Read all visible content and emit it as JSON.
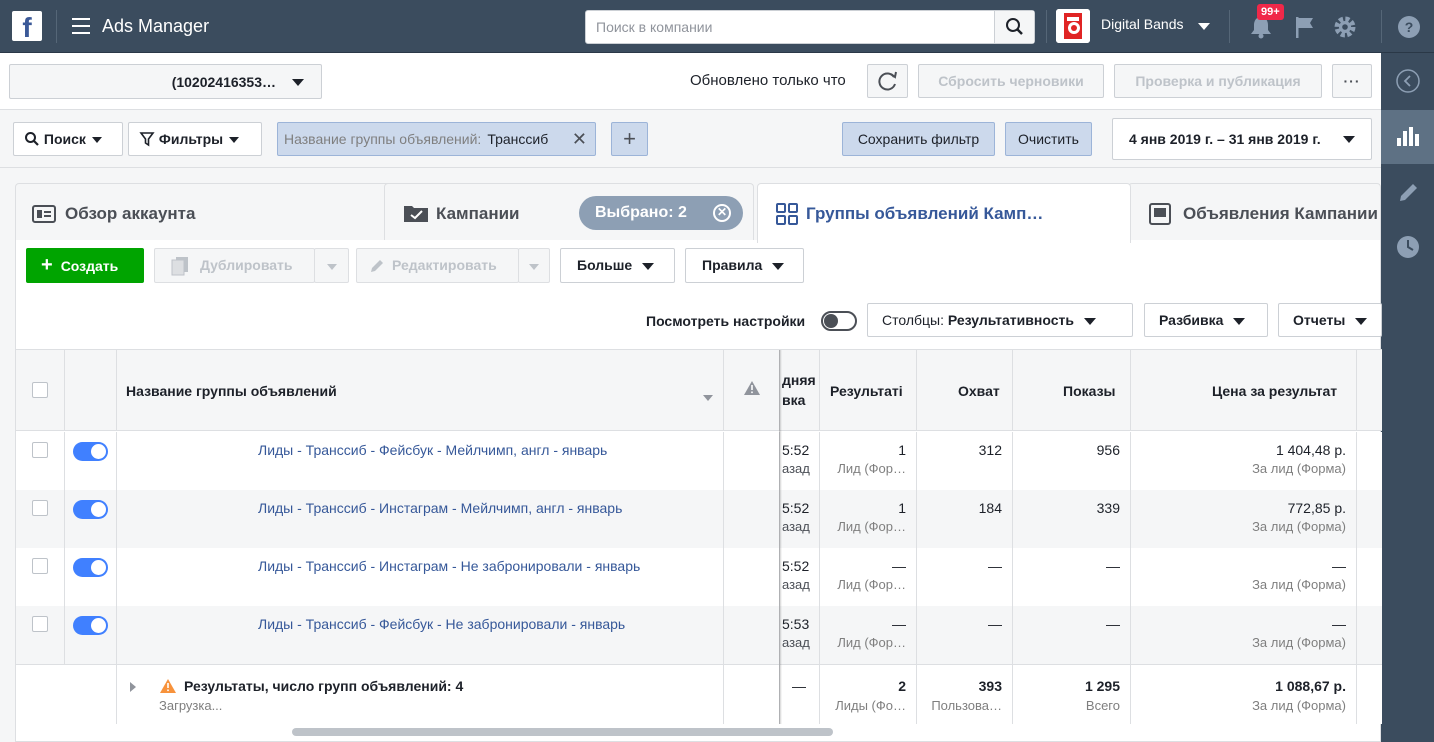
{
  "topbar": {
    "logo_letter": "f",
    "app_title": "Ads Manager",
    "search_placeholder": "Поиск в компании",
    "brand_name": "Digital Bands",
    "notifications_badge": "99+"
  },
  "account_bar": {
    "account_id": "(10202416353…",
    "updated_text": "Обновлено только что",
    "discard_label": "Сбросить черновики",
    "publish_label": "Проверка и публикация",
    "more_label": "···"
  },
  "filter_bar": {
    "search_label": "Поиск",
    "filters_label": "Фильтры",
    "chip_label": "Название группы объявлений:",
    "chip_value": "Транссиб",
    "save_filter_label": "Сохранить фильтр",
    "clear_label": "Очистить",
    "date_range": "4 янв 2019 г. – 31 янв 2019 г."
  },
  "tabs": {
    "overview": "Обзор аккаунта",
    "campaigns": "Кампании",
    "selected_pill": "Выбрано: 2",
    "adsets": "Группы объявлений Камп…",
    "ads": "Объявления Кампании"
  },
  "toolbar": {
    "create_label": "Создать",
    "duplicate_label": "Дублировать",
    "edit_label": "Редактировать",
    "more_label": "Больше",
    "rules_label": "Правила",
    "view_settings_label": "Посмотреть настройки",
    "columns_label": "Столбцы: ",
    "columns_value": "Результативность",
    "breakdown_label": "Разбивка",
    "reports_label": "Отчеты"
  },
  "table": {
    "headers": {
      "name": "Название группы объявлений",
      "partial_top": "дняя",
      "partial_bottom": "вка",
      "results": "Результаті",
      "reach": "Охват",
      "impressions": "Показы",
      "cost": "Цена за результат"
    },
    "rows": [
      {
        "name": "Лиды - Транссиб - Фейсбук - Мейлчимп, англ - январь",
        "time": "5:52",
        "time_sub": "азад",
        "results": "1",
        "results_sub": "Лид (Фор…",
        "reach": "312",
        "impressions": "956",
        "cost": "1 404,48 р.",
        "cost_sub": "За лид (Форма)"
      },
      {
        "name": "Лиды - Транссиб - Инстаграм - Мейлчимп, англ - январь",
        "time": "5:52",
        "time_sub": "азад",
        "results": "1",
        "results_sub": "Лид (Фор…",
        "reach": "184",
        "impressions": "339",
        "cost": "772,85 р.",
        "cost_sub": "За лид (Форма)"
      },
      {
        "name": "Лиды - Транссиб - Инстаграм - Не забронировали - январь",
        "time": "5:52",
        "time_sub": "азад",
        "results": "—",
        "results_sub": "Лид (Фор…",
        "reach": "—",
        "impressions": "—",
        "cost": "—",
        "cost_sub": "За лид (Форма)"
      },
      {
        "name": "Лиды - Транссиб - Фейсбук - Не забронировали - январь",
        "time": "5:53",
        "time_sub": "азад",
        "results": "—",
        "results_sub": "Лид (Фор…",
        "reach": "—",
        "impressions": "—",
        "cost": "—",
        "cost_sub": "За лид (Форма)"
      }
    ],
    "summary": {
      "title": "Результаты, число групп объявлений: 4",
      "loading": "Загрузка...",
      "time": "—",
      "results": "2",
      "results_sub": "Лиды (Фо…",
      "reach": "393",
      "reach_sub": "Пользова…",
      "impressions": "1 295",
      "impressions_sub": "Всего",
      "cost": "1 088,67 р.",
      "cost_sub": "За лид (Форма)"
    }
  },
  "colors": {
    "topbar": "#3b4c5e",
    "create_green": "#00a400",
    "toggle_blue": "#4080ff",
    "link_blue": "#365899"
  }
}
